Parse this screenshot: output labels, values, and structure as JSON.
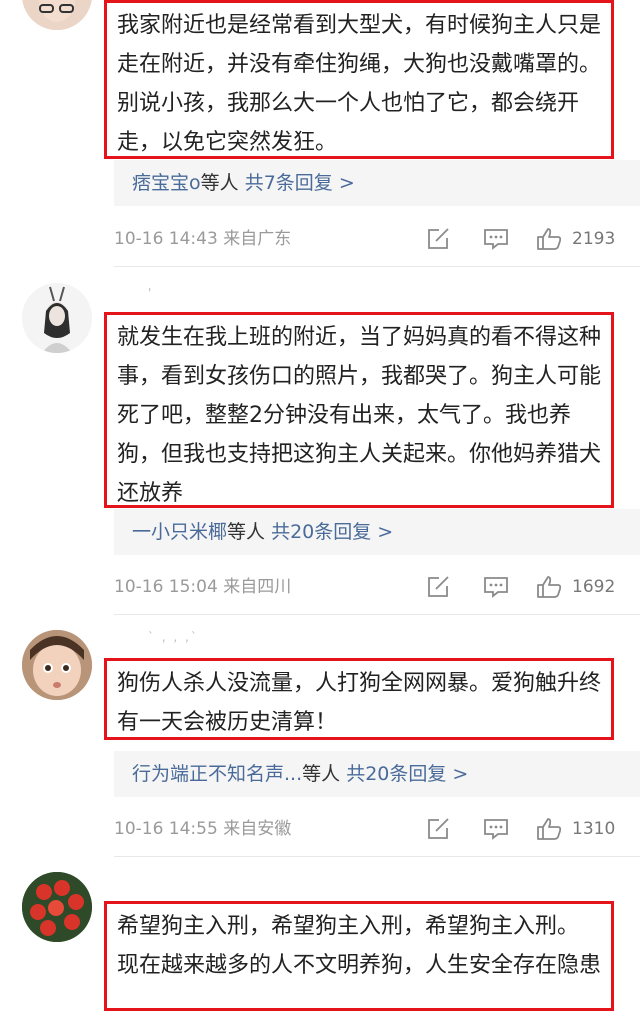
{
  "colors": {
    "highlight_border": "#e5141b",
    "reply_link": "#4a6b99",
    "reply_bg": "#f5f5f5",
    "meta_text": "#9a9a9a"
  },
  "comments": [
    {
      "text": "我家附近也是经常看到大型犬，有时候狗主人只是走在附近，并没有牵住狗绳，大狗也没戴嘴罩的。别说小孩，我那么大一个人也怕了它，都会绕开走，以免它突然发狂。",
      "replies": {
        "names": "痞宝宝o",
        "mid": "等人",
        "count_label": "共7条回复 >"
      },
      "time": "10-16 14:43",
      "location": "来自广东",
      "likes": "2193"
    },
    {
      "username": "'",
      "text": "就发生在我上班的附近，当了妈妈真的看不得这种事，看到女孩伤口的照片，我都哭了。狗主人可能死了吧，整整2分钟没有出来，太气了。我也养狗，但我也支持把这狗主人关起来。你他妈养猎犬还放养",
      "replies": {
        "names": "一小只米椰",
        "mid": "等人",
        "count_label": "共20条回复 >"
      },
      "time": "10-16 15:04",
      "location": "来自四川",
      "likes": "1692"
    },
    {
      "username": "` ,  ,  ,ˋ",
      "text": "狗伤人杀人没流量，人打狗全网网暴。爱狗触升终有一天会被历史清算！",
      "replies": {
        "names": "行为端正不知名声...",
        "mid": "等人",
        "count_label": "共20条回复 >"
      },
      "time": "10-16 14:55",
      "location": "来自安徽",
      "likes": "1310"
    },
    {
      "text": "希望狗主入刑，希望狗主入刑，希望狗主入刑。 现在越来越多的人不文明养狗，人生安全存在隐患"
    }
  ]
}
